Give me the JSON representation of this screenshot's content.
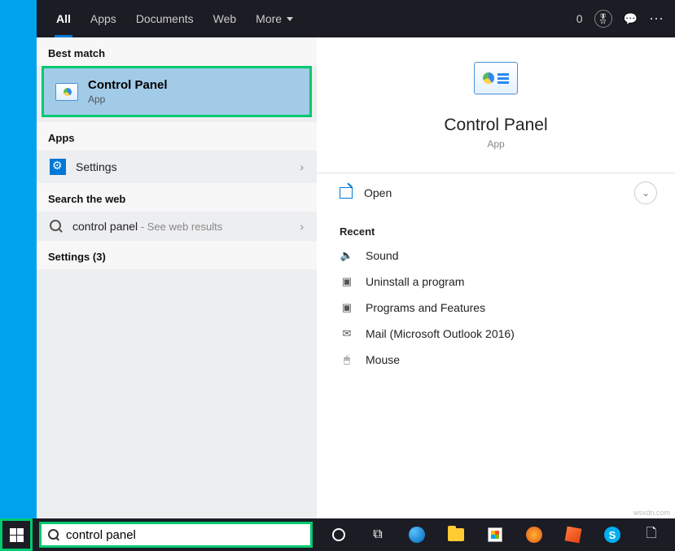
{
  "tabs": {
    "all": "All",
    "apps": "Apps",
    "documents": "Documents",
    "web": "Web",
    "more": "More"
  },
  "top_right": {
    "count": "0"
  },
  "sections": {
    "best_match": "Best match",
    "apps": "Apps",
    "search_web": "Search the web",
    "settings_count": "Settings (3)"
  },
  "best": {
    "title": "Control Panel",
    "sub": "App"
  },
  "apps_row": {
    "label": "Settings"
  },
  "web_row": {
    "label": "control panel",
    "suffix": " - See web results"
  },
  "preview": {
    "title": "Control Panel",
    "sub": "App",
    "open": "Open",
    "recent_label": "Recent",
    "recent": [
      {
        "label": "Sound",
        "icon": "🔈"
      },
      {
        "label": "Uninstall a program",
        "icon": "▣"
      },
      {
        "label": "Programs and Features",
        "icon": "▣"
      },
      {
        "label": "Mail (Microsoft Outlook 2016)",
        "icon": "✉"
      },
      {
        "label": "Mouse",
        "icon": "🖱"
      }
    ]
  },
  "search_input": "control panel",
  "watermark": "wsxdn.com"
}
